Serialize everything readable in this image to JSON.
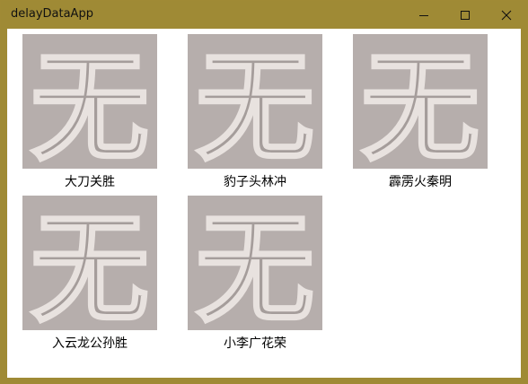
{
  "window": {
    "title": "delayDataApp"
  },
  "titlebar_buttons": {
    "minimize_icon": "minimize-icon",
    "maximize_icon": "maximize-icon",
    "close_icon": "close-icon"
  },
  "placeholder_glyph": "无",
  "items": [
    {
      "name": "大刀关胜"
    },
    {
      "name": "豹子头林冲"
    },
    {
      "name": "霹雳火秦明"
    },
    {
      "name": "入云龙公孙胜"
    },
    {
      "name": "小李广花荣"
    }
  ],
  "colors": {
    "titlebar": "#9f8a35",
    "thumb_bg": "#b6aeac",
    "glyph_fill": "#a59d9b",
    "glyph_stroke": "#e8e2df"
  }
}
